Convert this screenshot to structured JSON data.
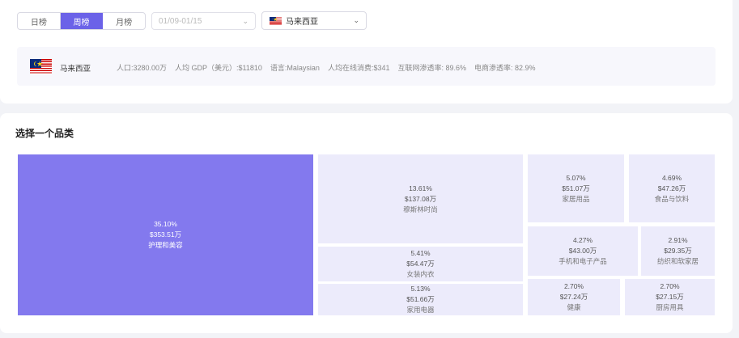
{
  "period_tabs": [
    "日榜",
    "周榜",
    "月榜"
  ],
  "active_tab": 1,
  "date_range": {
    "placeholder": "01/09-01/15"
  },
  "country_select": {
    "value": "马来西亚"
  },
  "country_info": {
    "name": "马来西亚",
    "stats": [
      "人口:3280.00万",
      "人均 GDP（美元）:$11810",
      "语言:Malaysian",
      "人均在线消费:$341",
      "互联网渗透率: 89.6%",
      "电商渗透率: 82.9%"
    ]
  },
  "section_title": "选择一个品类",
  "colors": {
    "accent": "#6b62e8",
    "primary_tile": "#8379ee",
    "tile": "#ecebfb"
  },
  "categories": [
    {
      "pct": "35.10%",
      "amount": "$353.51万",
      "name": "护理和美容"
    },
    {
      "pct": "13.61%",
      "amount": "$137.08万",
      "name": "穆斯林时尚"
    },
    {
      "pct": "5.41%",
      "amount": "$54.47万",
      "name": "女装内衣"
    },
    {
      "pct": "5.13%",
      "amount": "$51.66万",
      "name": "家用电器"
    },
    {
      "pct": "5.07%",
      "amount": "$51.07万",
      "name": "家居用品"
    },
    {
      "pct": "4.69%",
      "amount": "$47.26万",
      "name": "食品与饮料"
    },
    {
      "pct": "4.27%",
      "amount": "$43.00万",
      "name": "手机和电子产品"
    },
    {
      "pct": "2.91%",
      "amount": "$29.35万",
      "name": "纺织和软家居"
    },
    {
      "pct": "2.70%",
      "amount": "$27.24万",
      "name": "健康"
    },
    {
      "pct": "2.70%",
      "amount": "$27.15万",
      "name": "厨房用具"
    }
  ]
}
